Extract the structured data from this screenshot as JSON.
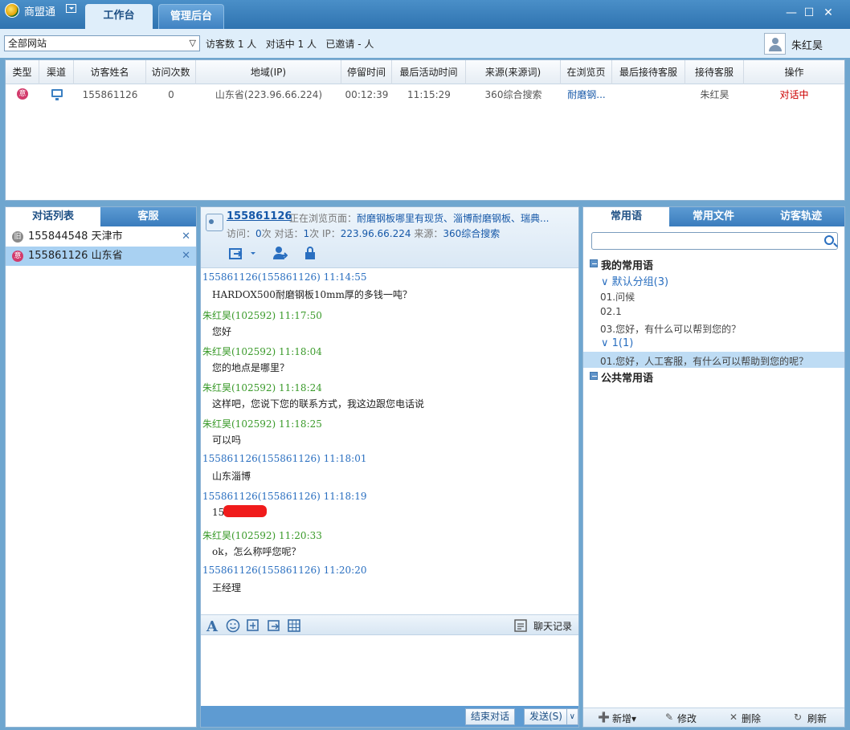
{
  "app": {
    "name": "商盟通",
    "tabs": [
      {
        "label": "工作台"
      },
      {
        "label": "管理后台"
      }
    ],
    "window_controls": {
      "minimize": "—",
      "maximize": "☐",
      "close": "✕"
    }
  },
  "filter_bar": {
    "site_select": "全部网站",
    "stats": "访客数 1 人   对话中 1 人   已邀请 - 人",
    "user_name": "朱红昊"
  },
  "visitor_table": {
    "headers": [
      "类型",
      "渠道",
      "访客姓名",
      "访问次数",
      "地域(IP)",
      "停留时间",
      "最后活动时间",
      "来源(来源词)",
      "在浏览页",
      "最后接待客服",
      "接待客服",
      "操作"
    ],
    "rows": [
      {
        "type_icon": "意",
        "name": "155861126",
        "visits": "0",
        "region": "山东省(223.96.66.224)",
        "stay": "00:12:39",
        "last_active": "11:15:29",
        "source": "360综合搜索",
        "page": "耐磨钢...",
        "last_agent": "",
        "agent": "朱红昊",
        "action": "对话中"
      }
    ]
  },
  "left_panel": {
    "tabs": [
      {
        "label": "对话列表"
      },
      {
        "label": "客服"
      }
    ],
    "conversations": [
      {
        "icon": "旧",
        "label": "155844548 天津市",
        "close": "✕"
      },
      {
        "icon": "意",
        "label": "155861126 山东省",
        "close": "✕"
      }
    ]
  },
  "chat": {
    "visitor_id": "155861126",
    "browsing_label": "正在浏览页面：",
    "browsing_page": "耐磨钢板哪里有现货、淄博耐磨钢板、瑞典...",
    "meta": {
      "visits_label": "访问：",
      "visits": "0",
      "visits_unit": "次 对话：",
      "chats": "1",
      "chats_unit": "次 IP：",
      "ip": "223.96.66.224",
      "source_label": " 来源：",
      "source": "360综合搜索"
    },
    "messages": [
      {
        "from": "visitor",
        "header": "155861126(155861126)  11:14:55",
        "body": "HARDOX500耐磨钢板10mm厚的多钱一吨？"
      },
      {
        "from": "agent",
        "header": "朱红昊(102592)  11:17:50",
        "body": "您好"
      },
      {
        "from": "agent",
        "header": "朱红昊(102592)  11:18:04",
        "body": "您的地点是哪里？"
      },
      {
        "from": "agent",
        "header": "朱红昊(102592)  11:18:24",
        "body": "这样吧，您说下您的联系方式，我这边跟您电话说"
      },
      {
        "from": "agent",
        "header": "朱红昊(102592)  11:18:25",
        "body": "可以吗"
      },
      {
        "from": "visitor",
        "header": "155861126(155861126)  11:18:01",
        "body": "山东淄博"
      },
      {
        "from": "visitor",
        "header": "155861126(155861126)  11:18:19",
        "body": "15"
      },
      {
        "from": "agent",
        "header": "朱红昊(102592)  11:20:33",
        "body": "ok，怎么称呼您呢？"
      },
      {
        "from": "visitor",
        "header": "155861126(155861126)  11:20:20",
        "body": "王经理"
      }
    ],
    "history_label": "聊天记录",
    "end_button": "结束对话",
    "send_button": "发送(S)"
  },
  "right_panel": {
    "tabs": [
      {
        "label": "常用语"
      },
      {
        "label": "常用文件"
      },
      {
        "label": "访客轨迹"
      }
    ],
    "search_placeholder": "",
    "tree": {
      "my_phrases": "我的常用语",
      "group_default": "默认分组(3)",
      "items_default": [
        "01.问候",
        "02.1",
        "03.您好，有什么可以帮到您的？"
      ],
      "group_1": "1(1)",
      "items_1": [
        "01.您好，人工客服，有什么可以帮助到您的呢？"
      ],
      "public_phrases": "公共常用语"
    },
    "footer": {
      "add": "新增▾",
      "edit": "修改",
      "delete": "删除",
      "refresh": "刷新"
    }
  },
  "colors": {
    "accent": "#2f73b0",
    "visitor_msg": "#2a6fc0",
    "agent_msg": "#3a9a2a",
    "action": "#cc0000"
  }
}
